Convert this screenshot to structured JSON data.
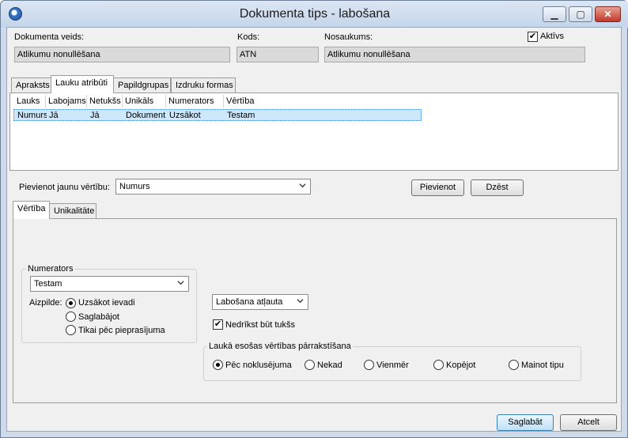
{
  "window": {
    "title": "Dokumenta tips - labošana"
  },
  "header": {
    "doc_type_label": "Dokumenta veids:",
    "doc_type_value": "Atlikumu nonullēšana",
    "code_label": "Kods:",
    "code_value": "ATN",
    "name_label": "Nosaukums:",
    "name_value": "Atlikumu nonullēšana",
    "active_label": "Aktīvs",
    "active_checked": true
  },
  "tabs": [
    {
      "label": "Apraksts",
      "active": false
    },
    {
      "label": "Lauku atribūti",
      "active": true
    },
    {
      "label": "Papildgrupas",
      "active": false
    },
    {
      "label": "Izdruku formas",
      "active": false
    }
  ],
  "grid": {
    "columns": [
      "Lauks",
      "Labojams",
      "Netukšs",
      "Unikāls",
      "Numerators",
      "Vērtība"
    ],
    "rows": [
      [
        "Numurs",
        "Jā",
        "Jā",
        "Dokument",
        "Uzsākot",
        "Testam"
      ]
    ]
  },
  "add_row": {
    "label": "Pievienot jaunu vērtību:",
    "combo_value": "Numurs",
    "add_button": "Pievienot",
    "delete_button": "Dzēst"
  },
  "subtabs": [
    {
      "label": "Vērtība",
      "active": true
    },
    {
      "label": "Unikalitāte",
      "active": false
    }
  ],
  "numerators": {
    "group_label": "Numerators",
    "combo_value": "Testam",
    "fill_label": "Aizpilde:",
    "options": [
      {
        "label": "Uzsākot ievadi",
        "selected": true
      },
      {
        "label": "Saglabājot",
        "selected": false
      },
      {
        "label": "Tikai pēc pieprasījuma",
        "selected": false
      }
    ]
  },
  "edit_combo_value": "Labošana atļauta",
  "not_empty": {
    "label": "Nedrīkst būt tukšs",
    "checked": true
  },
  "overwrite": {
    "group_label": "Laukā esošas vērtības pārrakstīšana",
    "options": [
      {
        "label": "Pēc noklusējuma",
        "selected": true
      },
      {
        "label": "Nekad",
        "selected": false
      },
      {
        "label": "Vienmēr",
        "selected": false
      },
      {
        "label": "Kopējot",
        "selected": false
      },
      {
        "label": "Mainot tipu",
        "selected": false
      }
    ]
  },
  "footer": {
    "save_button": "Saglabāt",
    "cancel_button": "Atcelt"
  }
}
